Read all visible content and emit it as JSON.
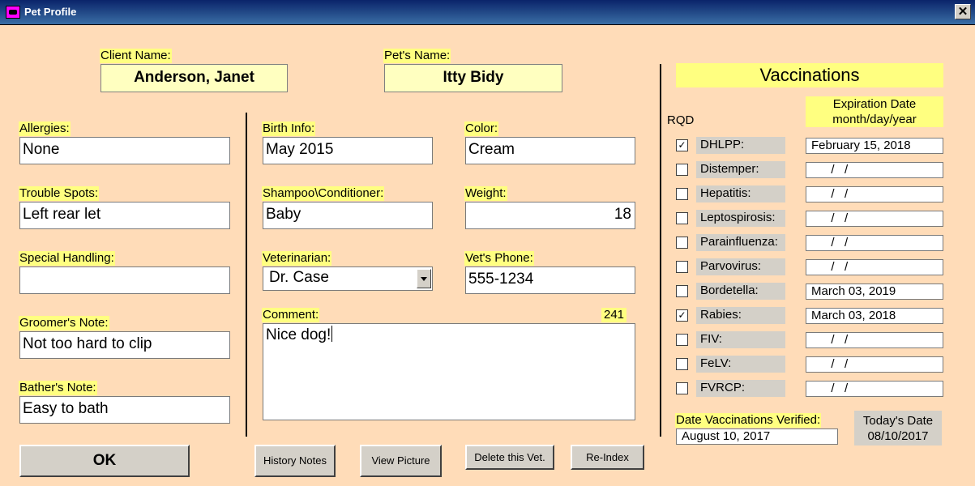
{
  "window": {
    "title": "Pet Profile",
    "close_glyph": "✕"
  },
  "client": {
    "label": "Client Name:",
    "value": "Anderson, Janet"
  },
  "pet": {
    "label": "Pet's Name:",
    "value": "Itty Bidy"
  },
  "left_fields": [
    {
      "label": "Allergies:",
      "value": "None"
    },
    {
      "label": "Trouble Spots:",
      "value": "Left rear let"
    },
    {
      "label": "Special Handling:",
      "value": ""
    },
    {
      "label": "Groomer's Note:",
      "value": "Not too hard to clip"
    },
    {
      "label": "Bather's Note:",
      "value": "Easy to bath"
    }
  ],
  "birth": {
    "label": "Birth Info:",
    "value": "May 2015"
  },
  "color": {
    "label": "Color:",
    "value": "Cream"
  },
  "shampoo": {
    "label": "Shampoo\\Conditioner:",
    "value": "Baby"
  },
  "weight": {
    "label": "Weight:",
    "value": "18"
  },
  "vet": {
    "label": "Veterinarian:",
    "value": "Dr. Case"
  },
  "vet_phone": {
    "label": "Vet's Phone:",
    "value": "555-1234"
  },
  "comment": {
    "label": "Comment:",
    "count": "241",
    "value": "Nice dog!"
  },
  "vaccinations": {
    "title": "Vaccinations",
    "rqd_label": "RQD",
    "exp_header_line1": "Expiration Date",
    "exp_header_line2": "month/day/year",
    "rows": [
      {
        "name": "DHLPP:",
        "checked": true,
        "date": "February 15, 2018"
      },
      {
        "name": "Distemper:",
        "checked": false,
        "date": "  /   /"
      },
      {
        "name": "Hepatitis:",
        "checked": false,
        "date": "  /   /"
      },
      {
        "name": "Leptospirosis:",
        "checked": false,
        "date": "  /   /"
      },
      {
        "name": "Parainfluenza:",
        "checked": false,
        "date": "  /   /"
      },
      {
        "name": "Parvovirus:",
        "checked": false,
        "date": "  /   /"
      },
      {
        "name": "Bordetella:",
        "checked": false,
        "date": "March 03, 2019"
      },
      {
        "name": "Rabies:",
        "checked": true,
        "date": "March 03, 2018"
      },
      {
        "name": "FIV:",
        "checked": false,
        "date": "  /   /"
      },
      {
        "name": "FeLV:",
        "checked": false,
        "date": "  /   /"
      },
      {
        "name": "FVRCP:",
        "checked": false,
        "date": "  /   /"
      }
    ],
    "verified_label": "Date Vaccinations Verified:",
    "verified_value": "August 10, 2017",
    "today_label": "Today's Date",
    "today_value": "08/10/2017"
  },
  "buttons": {
    "ok": "OK",
    "history": "History Notes",
    "view_picture": "View Picture",
    "delete_vet": "Delete this Vet.",
    "reindex": "Re-Index"
  },
  "colors": {
    "background": "#ffdcb8",
    "label_highlight": "#ffff80",
    "name_field": "#ffffc0"
  }
}
